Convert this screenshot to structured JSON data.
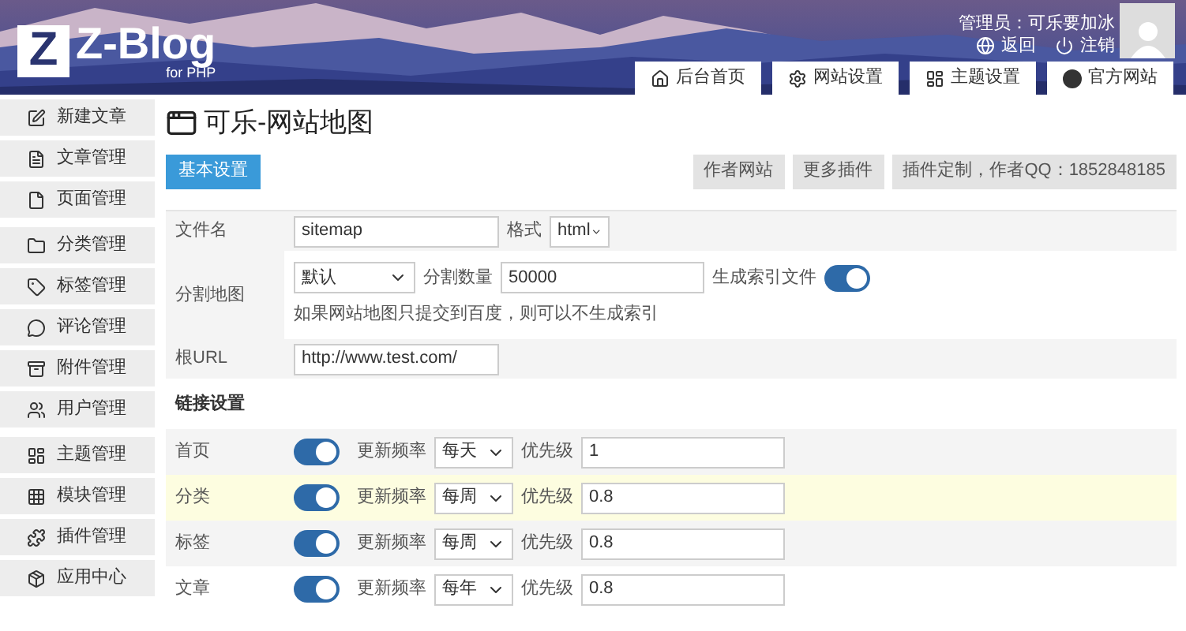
{
  "header": {
    "logo_letter": "Z",
    "logo_text": "Z-Blog",
    "logo_sub": "for PHP",
    "user": "管理员：可乐要加冰",
    "links": [
      {
        "kind": "back",
        "label": "返回"
      },
      {
        "kind": "logout",
        "label": "注销"
      }
    ],
    "tabs": [
      {
        "label": "后台首页",
        "selected": false
      },
      {
        "label": "网站设置",
        "selected": false
      },
      {
        "label": "主题设置",
        "selected": false
      },
      {
        "label": "官方网站",
        "selected": false
      }
    ]
  },
  "sidebar": {
    "groups": [
      [
        {
          "label": "新建文章"
        },
        {
          "label": "文章管理"
        },
        {
          "label": "页面管理"
        }
      ],
      [
        {
          "label": "分类管理"
        },
        {
          "label": "标签管理"
        },
        {
          "label": "评论管理"
        },
        {
          "label": "附件管理"
        },
        {
          "label": "用户管理"
        }
      ],
      [
        {
          "label": "主题管理"
        },
        {
          "label": "模块管理"
        },
        {
          "label": "插件管理"
        },
        {
          "label": "应用中心"
        }
      ]
    ]
  },
  "page": {
    "title": "可乐-网站地图",
    "tabs": [
      {
        "label": "基本设置",
        "selected": true
      }
    ],
    "links": [
      "作者网站",
      "更多插件",
      "插件定制，作者QQ：1852848185"
    ]
  },
  "settings": {
    "filename": {
      "label": "文件名",
      "value": "sitemap",
      "format_label": "格式",
      "format": "html"
    },
    "split": {
      "label": "分割地图",
      "mode": "默认",
      "count_label": "分割数量",
      "count": "50000",
      "index_label": "生成索引文件",
      "index_on": true,
      "hint": "如果网站地图只提交到百度，则可以不生成索引"
    },
    "root": {
      "label": "根URL",
      "value": "http://www.test.com/"
    },
    "links_heading": "链接设置",
    "link_rows": [
      {
        "label": "首页",
        "on": true,
        "freq_label": "更新频率",
        "freq": "每天",
        "priority_label": "优先级",
        "priority": "1",
        "selected": false
      },
      {
        "label": "分类",
        "on": true,
        "freq_label": "更新频率",
        "freq": "每周",
        "priority_label": "优先级",
        "priority": "0.8",
        "selected": true
      },
      {
        "label": "标签",
        "on": true,
        "freq_label": "更新频率",
        "freq": "每周",
        "priority_label": "优先级",
        "priority": "0.8",
        "selected": false
      },
      {
        "label": "文章",
        "on": true,
        "freq_label": "更新频率",
        "freq": "每年",
        "priority_label": "优先级",
        "priority": "0.8",
        "selected": false
      }
    ]
  }
}
